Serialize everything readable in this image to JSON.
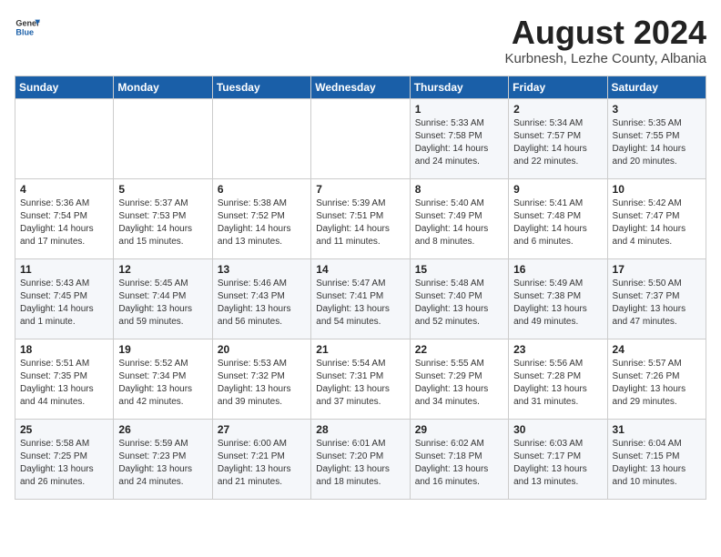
{
  "header": {
    "logo_general": "General",
    "logo_blue": "Blue",
    "month_year": "August 2024",
    "location": "Kurbnesh, Lezhe County, Albania"
  },
  "weekdays": [
    "Sunday",
    "Monday",
    "Tuesday",
    "Wednesday",
    "Thursday",
    "Friday",
    "Saturday"
  ],
  "weeks": [
    [
      {
        "day": "",
        "sunrise": "",
        "sunset": "",
        "daylight": ""
      },
      {
        "day": "",
        "sunrise": "",
        "sunset": "",
        "daylight": ""
      },
      {
        "day": "",
        "sunrise": "",
        "sunset": "",
        "daylight": ""
      },
      {
        "day": "",
        "sunrise": "",
        "sunset": "",
        "daylight": ""
      },
      {
        "day": "1",
        "sunrise": "Sunrise: 5:33 AM",
        "sunset": "Sunset: 7:58 PM",
        "daylight": "Daylight: 14 hours and 24 minutes."
      },
      {
        "day": "2",
        "sunrise": "Sunrise: 5:34 AM",
        "sunset": "Sunset: 7:57 PM",
        "daylight": "Daylight: 14 hours and 22 minutes."
      },
      {
        "day": "3",
        "sunrise": "Sunrise: 5:35 AM",
        "sunset": "Sunset: 7:55 PM",
        "daylight": "Daylight: 14 hours and 20 minutes."
      }
    ],
    [
      {
        "day": "4",
        "sunrise": "Sunrise: 5:36 AM",
        "sunset": "Sunset: 7:54 PM",
        "daylight": "Daylight: 14 hours and 17 minutes."
      },
      {
        "day": "5",
        "sunrise": "Sunrise: 5:37 AM",
        "sunset": "Sunset: 7:53 PM",
        "daylight": "Daylight: 14 hours and 15 minutes."
      },
      {
        "day": "6",
        "sunrise": "Sunrise: 5:38 AM",
        "sunset": "Sunset: 7:52 PM",
        "daylight": "Daylight: 14 hours and 13 minutes."
      },
      {
        "day": "7",
        "sunrise": "Sunrise: 5:39 AM",
        "sunset": "Sunset: 7:51 PM",
        "daylight": "Daylight: 14 hours and 11 minutes."
      },
      {
        "day": "8",
        "sunrise": "Sunrise: 5:40 AM",
        "sunset": "Sunset: 7:49 PM",
        "daylight": "Daylight: 14 hours and 8 minutes."
      },
      {
        "day": "9",
        "sunrise": "Sunrise: 5:41 AM",
        "sunset": "Sunset: 7:48 PM",
        "daylight": "Daylight: 14 hours and 6 minutes."
      },
      {
        "day": "10",
        "sunrise": "Sunrise: 5:42 AM",
        "sunset": "Sunset: 7:47 PM",
        "daylight": "Daylight: 14 hours and 4 minutes."
      }
    ],
    [
      {
        "day": "11",
        "sunrise": "Sunrise: 5:43 AM",
        "sunset": "Sunset: 7:45 PM",
        "daylight": "Daylight: 14 hours and 1 minute."
      },
      {
        "day": "12",
        "sunrise": "Sunrise: 5:45 AM",
        "sunset": "Sunset: 7:44 PM",
        "daylight": "Daylight: 13 hours and 59 minutes."
      },
      {
        "day": "13",
        "sunrise": "Sunrise: 5:46 AM",
        "sunset": "Sunset: 7:43 PM",
        "daylight": "Daylight: 13 hours and 56 minutes."
      },
      {
        "day": "14",
        "sunrise": "Sunrise: 5:47 AM",
        "sunset": "Sunset: 7:41 PM",
        "daylight": "Daylight: 13 hours and 54 minutes."
      },
      {
        "day": "15",
        "sunrise": "Sunrise: 5:48 AM",
        "sunset": "Sunset: 7:40 PM",
        "daylight": "Daylight: 13 hours and 52 minutes."
      },
      {
        "day": "16",
        "sunrise": "Sunrise: 5:49 AM",
        "sunset": "Sunset: 7:38 PM",
        "daylight": "Daylight: 13 hours and 49 minutes."
      },
      {
        "day": "17",
        "sunrise": "Sunrise: 5:50 AM",
        "sunset": "Sunset: 7:37 PM",
        "daylight": "Daylight: 13 hours and 47 minutes."
      }
    ],
    [
      {
        "day": "18",
        "sunrise": "Sunrise: 5:51 AM",
        "sunset": "Sunset: 7:35 PM",
        "daylight": "Daylight: 13 hours and 44 minutes."
      },
      {
        "day": "19",
        "sunrise": "Sunrise: 5:52 AM",
        "sunset": "Sunset: 7:34 PM",
        "daylight": "Daylight: 13 hours and 42 minutes."
      },
      {
        "day": "20",
        "sunrise": "Sunrise: 5:53 AM",
        "sunset": "Sunset: 7:32 PM",
        "daylight": "Daylight: 13 hours and 39 minutes."
      },
      {
        "day": "21",
        "sunrise": "Sunrise: 5:54 AM",
        "sunset": "Sunset: 7:31 PM",
        "daylight": "Daylight: 13 hours and 37 minutes."
      },
      {
        "day": "22",
        "sunrise": "Sunrise: 5:55 AM",
        "sunset": "Sunset: 7:29 PM",
        "daylight": "Daylight: 13 hours and 34 minutes."
      },
      {
        "day": "23",
        "sunrise": "Sunrise: 5:56 AM",
        "sunset": "Sunset: 7:28 PM",
        "daylight": "Daylight: 13 hours and 31 minutes."
      },
      {
        "day": "24",
        "sunrise": "Sunrise: 5:57 AM",
        "sunset": "Sunset: 7:26 PM",
        "daylight": "Daylight: 13 hours and 29 minutes."
      }
    ],
    [
      {
        "day": "25",
        "sunrise": "Sunrise: 5:58 AM",
        "sunset": "Sunset: 7:25 PM",
        "daylight": "Daylight: 13 hours and 26 minutes."
      },
      {
        "day": "26",
        "sunrise": "Sunrise: 5:59 AM",
        "sunset": "Sunset: 7:23 PM",
        "daylight": "Daylight: 13 hours and 24 minutes."
      },
      {
        "day": "27",
        "sunrise": "Sunrise: 6:00 AM",
        "sunset": "Sunset: 7:21 PM",
        "daylight": "Daylight: 13 hours and 21 minutes."
      },
      {
        "day": "28",
        "sunrise": "Sunrise: 6:01 AM",
        "sunset": "Sunset: 7:20 PM",
        "daylight": "Daylight: 13 hours and 18 minutes."
      },
      {
        "day": "29",
        "sunrise": "Sunrise: 6:02 AM",
        "sunset": "Sunset: 7:18 PM",
        "daylight": "Daylight: 13 hours and 16 minutes."
      },
      {
        "day": "30",
        "sunrise": "Sunrise: 6:03 AM",
        "sunset": "Sunset: 7:17 PM",
        "daylight": "Daylight: 13 hours and 13 minutes."
      },
      {
        "day": "31",
        "sunrise": "Sunrise: 6:04 AM",
        "sunset": "Sunset: 7:15 PM",
        "daylight": "Daylight: 13 hours and 10 minutes."
      }
    ]
  ]
}
